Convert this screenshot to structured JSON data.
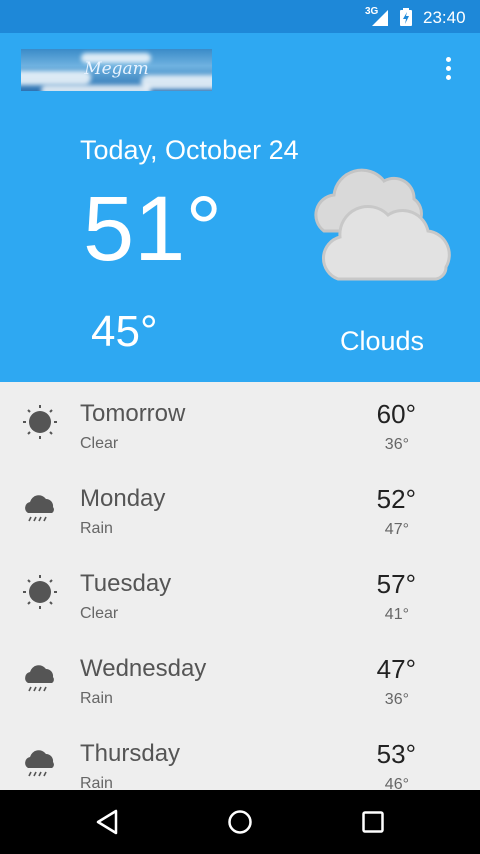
{
  "status": {
    "network": "3G",
    "time": "23:40"
  },
  "header": {
    "logo_text": "Megam",
    "date": "Today, October 24",
    "high": "51°",
    "low": "45°",
    "condition": "Clouds",
    "weather_icon": "clouds-icon"
  },
  "forecast": [
    {
      "day": "Tomorrow",
      "desc": "Clear",
      "hi": "60°",
      "lo": "36°",
      "icon": "sun-icon"
    },
    {
      "day": "Monday",
      "desc": "Rain",
      "hi": "52°",
      "lo": "47°",
      "icon": "rain-icon"
    },
    {
      "day": "Tuesday",
      "desc": "Clear",
      "hi": "57°",
      "lo": "41°",
      "icon": "sun-icon"
    },
    {
      "day": "Wednesday",
      "desc": "Rain",
      "hi": "47°",
      "lo": "36°",
      "icon": "rain-icon"
    },
    {
      "day": "Thursday",
      "desc": "Rain",
      "hi": "53°",
      "lo": "46°",
      "icon": "rain-icon"
    }
  ],
  "colors": {
    "status_bar": "#1e88d8",
    "header": "#2ea8f2",
    "list_bg": "#eeeeee"
  }
}
